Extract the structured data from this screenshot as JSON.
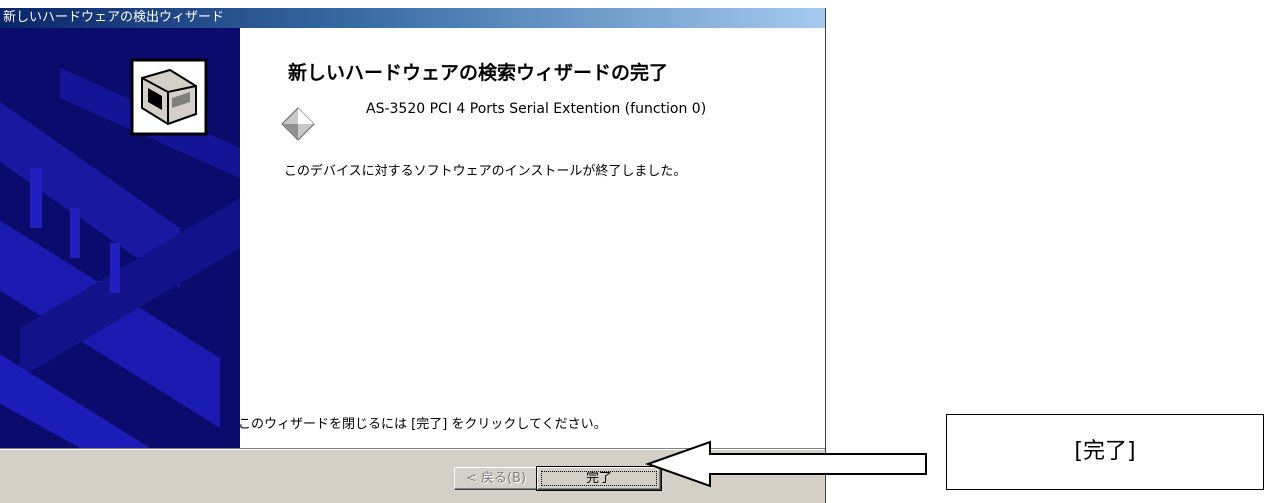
{
  "dialog": {
    "title": "新しいハードウェアの検出ウィザード",
    "heading": "新しいハードウェアの検索ウィザードの完了",
    "device_name": "AS-3520 PCI 4 Ports Serial Extention (function 0)",
    "status_text": "このデバイスに対するソフトウェアのインストールが終了しました。",
    "close_hint": "このウィザードを閉じるには [完了] をクリックしてください。",
    "buttons": {
      "back_label": "< 戻る(B)",
      "finish_label": "完了"
    },
    "icons": {
      "wizard": "hardware-card-icon",
      "device": "device-diamond-icon"
    },
    "colors": {
      "title_bar_start": "#0a246a",
      "side_panel": "#0b0b6e",
      "dialog_face": "#d4d0c8"
    }
  },
  "annotation": {
    "callout_label": "[完了]"
  }
}
